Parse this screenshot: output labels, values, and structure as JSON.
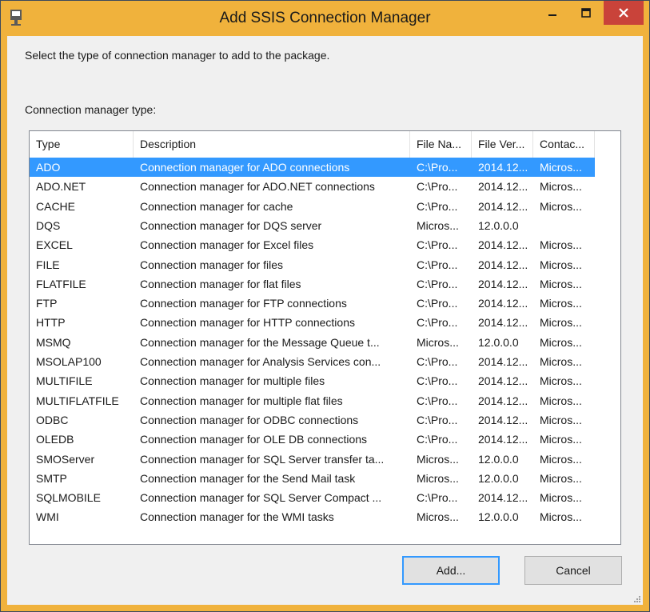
{
  "window": {
    "title": "Add SSIS Connection Manager",
    "accent_color": "#f0b23c",
    "close_color": "#c9433a"
  },
  "prompt": "Select the type of connection manager to add to the package.",
  "group_label": "Connection manager type:",
  "columns": [
    "Type",
    "Description",
    "File Na...",
    "File Ver...",
    "Contac..."
  ],
  "rows": [
    {
      "type": "ADO",
      "description": "Connection manager for ADO connections",
      "file_name": "C:\\Pro...",
      "file_version": "2014.12...",
      "contact": "Micros...",
      "selected": true
    },
    {
      "type": "ADO.NET",
      "description": "Connection manager for ADO.NET connections",
      "file_name": "C:\\Pro...",
      "file_version": "2014.12...",
      "contact": "Micros..."
    },
    {
      "type": "CACHE",
      "description": "Connection manager for cache",
      "file_name": "C:\\Pro...",
      "file_version": "2014.12...",
      "contact": "Micros..."
    },
    {
      "type": "DQS",
      "description": "Connection manager for DQS server",
      "file_name": "Micros...",
      "file_version": "12.0.0.0",
      "contact": ""
    },
    {
      "type": "EXCEL",
      "description": "Connection manager for Excel files",
      "file_name": "C:\\Pro...",
      "file_version": "2014.12...",
      "contact": "Micros..."
    },
    {
      "type": "FILE",
      "description": "Connection manager for files",
      "file_name": "C:\\Pro...",
      "file_version": "2014.12...",
      "contact": "Micros..."
    },
    {
      "type": "FLATFILE",
      "description": "Connection manager for flat files",
      "file_name": "C:\\Pro...",
      "file_version": "2014.12...",
      "contact": "Micros..."
    },
    {
      "type": "FTP",
      "description": "Connection manager for FTP connections",
      "file_name": "C:\\Pro...",
      "file_version": "2014.12...",
      "contact": "Micros..."
    },
    {
      "type": "HTTP",
      "description": "Connection manager for HTTP connections",
      "file_name": "C:\\Pro...",
      "file_version": "2014.12...",
      "contact": "Micros..."
    },
    {
      "type": "MSMQ",
      "description": "Connection manager for the Message Queue t...",
      "file_name": "Micros...",
      "file_version": "12.0.0.0",
      "contact": "Micros..."
    },
    {
      "type": "MSOLAP100",
      "description": "Connection manager for Analysis Services con...",
      "file_name": "C:\\Pro...",
      "file_version": "2014.12...",
      "contact": "Micros..."
    },
    {
      "type": "MULTIFILE",
      "description": "Connection manager for multiple files",
      "file_name": "C:\\Pro...",
      "file_version": "2014.12...",
      "contact": "Micros..."
    },
    {
      "type": "MULTIFLATFILE",
      "description": "Connection manager for multiple flat files",
      "file_name": "C:\\Pro...",
      "file_version": "2014.12...",
      "contact": "Micros..."
    },
    {
      "type": "ODBC",
      "description": "Connection manager for ODBC connections",
      "file_name": "C:\\Pro...",
      "file_version": "2014.12...",
      "contact": "Micros..."
    },
    {
      "type": "OLEDB",
      "description": "Connection manager for OLE DB connections",
      "file_name": "C:\\Pro...",
      "file_version": "2014.12...",
      "contact": "Micros..."
    },
    {
      "type": "SMOServer",
      "description": "Connection manager for SQL Server transfer ta...",
      "file_name": "Micros...",
      "file_version": "12.0.0.0",
      "contact": "Micros..."
    },
    {
      "type": "SMTP",
      "description": "Connection manager for the Send Mail task",
      "file_name": "Micros...",
      "file_version": "12.0.0.0",
      "contact": "Micros..."
    },
    {
      "type": "SQLMOBILE",
      "description": "Connection manager for SQL Server Compact ...",
      "file_name": "C:\\Pro...",
      "file_version": "2014.12...",
      "contact": "Micros..."
    },
    {
      "type": "WMI",
      "description": "Connection manager for the WMI tasks",
      "file_name": "Micros...",
      "file_version": "12.0.0.0",
      "contact": "Micros..."
    }
  ],
  "buttons": {
    "add": "Add...",
    "cancel": "Cancel"
  }
}
